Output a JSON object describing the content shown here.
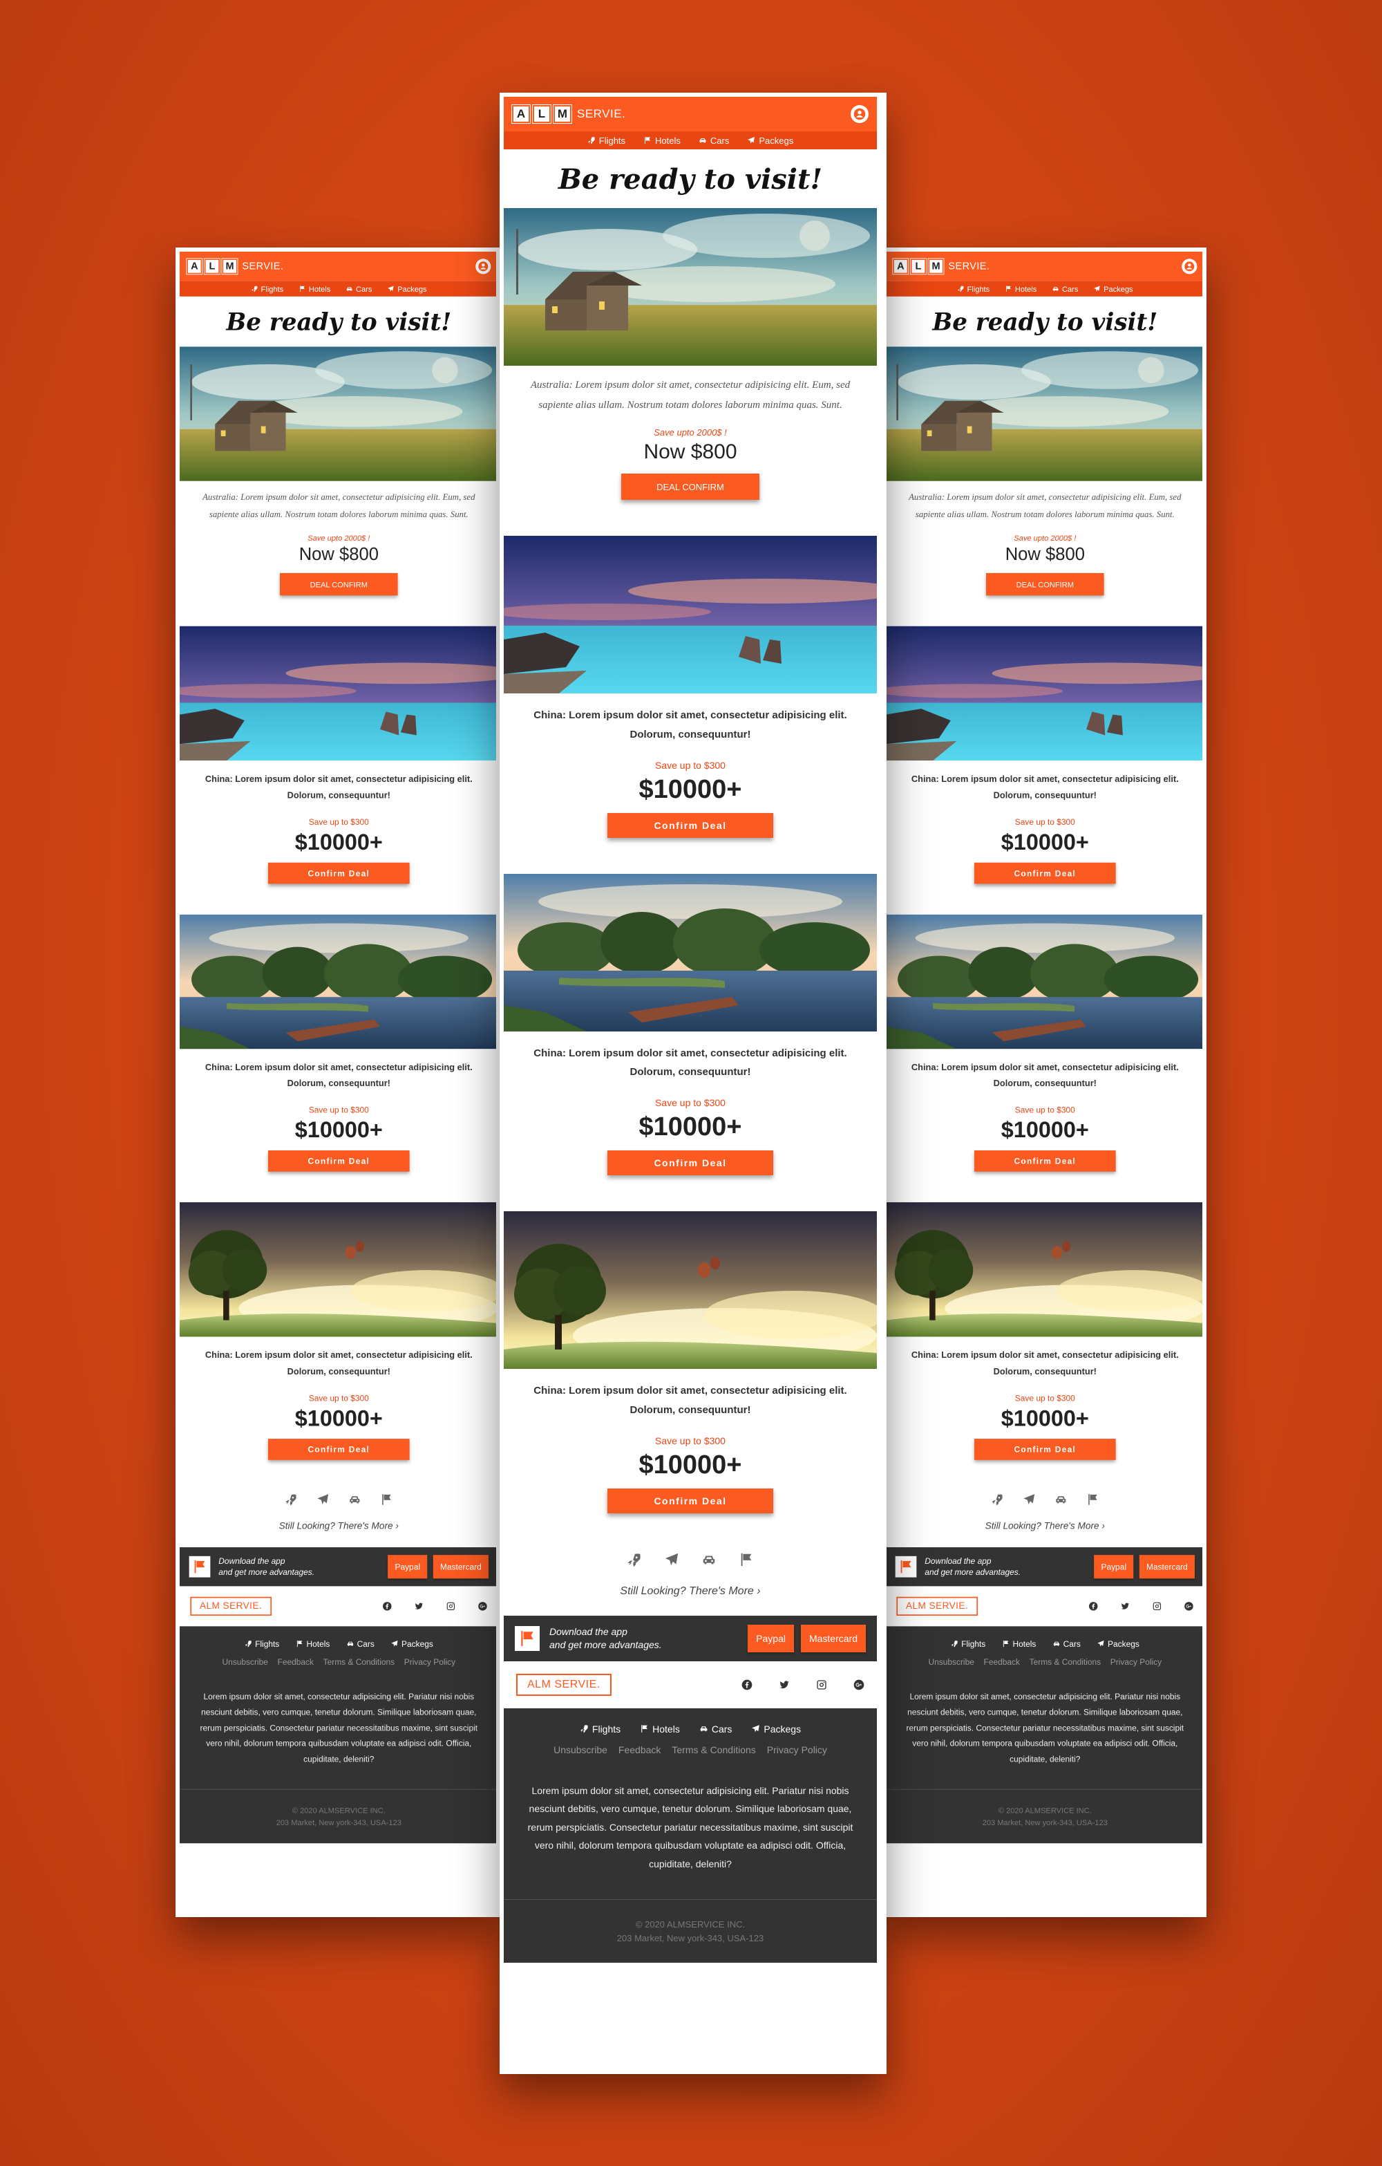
{
  "header": {
    "logo_letters": [
      "A",
      "L",
      "M"
    ],
    "logo_word": "SERVIE."
  },
  "nav": [
    {
      "label": "Flights",
      "icon": "rocket-icon"
    },
    {
      "label": "Hotels",
      "icon": "flag-icon"
    },
    {
      "label": "Cars",
      "icon": "car-icon"
    },
    {
      "label": "Packegs",
      "icon": "paper-plane-icon"
    }
  ],
  "headline": "Be ready to visit!",
  "featured": {
    "desc": "Australia: Lorem ipsum dolor sit amet, consectetur adipisicing elit. Eum, sed sapiente alias ullam. Nostrum totam dolores laborum minima quas. Sunt.",
    "save": "Save upto 2000$ !",
    "price": "Now $800",
    "button": "DEAL CONFIRM"
  },
  "deals": [
    {
      "country": "China:",
      "desc": " Lorem ipsum dolor sit amet, consectetur adipisicing elit. Dolorum, consequuntur!",
      "save": "Save up to $300",
      "price": "$10000+",
      "button": "Confirm Deal",
      "image": "sea-rocks"
    },
    {
      "country": "China:",
      "desc": " Lorem ipsum dolor sit amet, consectetur adipisicing elit. Dolorum, consequuntur!",
      "save": "Save up to $300",
      "price": "$10000+",
      "button": "Confirm Deal",
      "image": "park-lake"
    },
    {
      "country": "China:",
      "desc": " Lorem ipsum dolor sit amet, consectetur adipisicing elit. Dolorum, consequuntur!",
      "save": "Save up to $300",
      "price": "$10000+",
      "button": "Confirm Deal",
      "image": "tree-balloons"
    }
  ],
  "still_looking": "Still Looking? There's More",
  "app": {
    "line1": "Download the app",
    "line2": "and get more advantages.",
    "paypal": "Paypal",
    "mastercard": "Mastercard"
  },
  "footer_logo": "ALM SERVIE.",
  "footer": {
    "links": [
      "Unsubscribe",
      "Feedback",
      "Terms & Conditions",
      "Privacy Policy"
    ],
    "text": "Lorem ipsum dolor sit amet, consectetur adipisicing elit. Pariatur nisi nobis nesciunt debitis, vero cumque, tenetur dolorum. Similique laboriosam quae, rerum perspiciatis. Consectetur pariatur necessitatibus maxime, sint suscipit vero nihil, dolorum tempora quibusdam voluptate ea adipisci odit. Officia, cupiditate, deleniti?",
    "copyright": "© 2020 ALMSERVICE INC.",
    "address": "203 Market, New york-343, USA-123"
  },
  "colors": {
    "brand": "#fb5a20",
    "nav": "#e84613",
    "dark": "#333333",
    "background": "#d44614"
  }
}
